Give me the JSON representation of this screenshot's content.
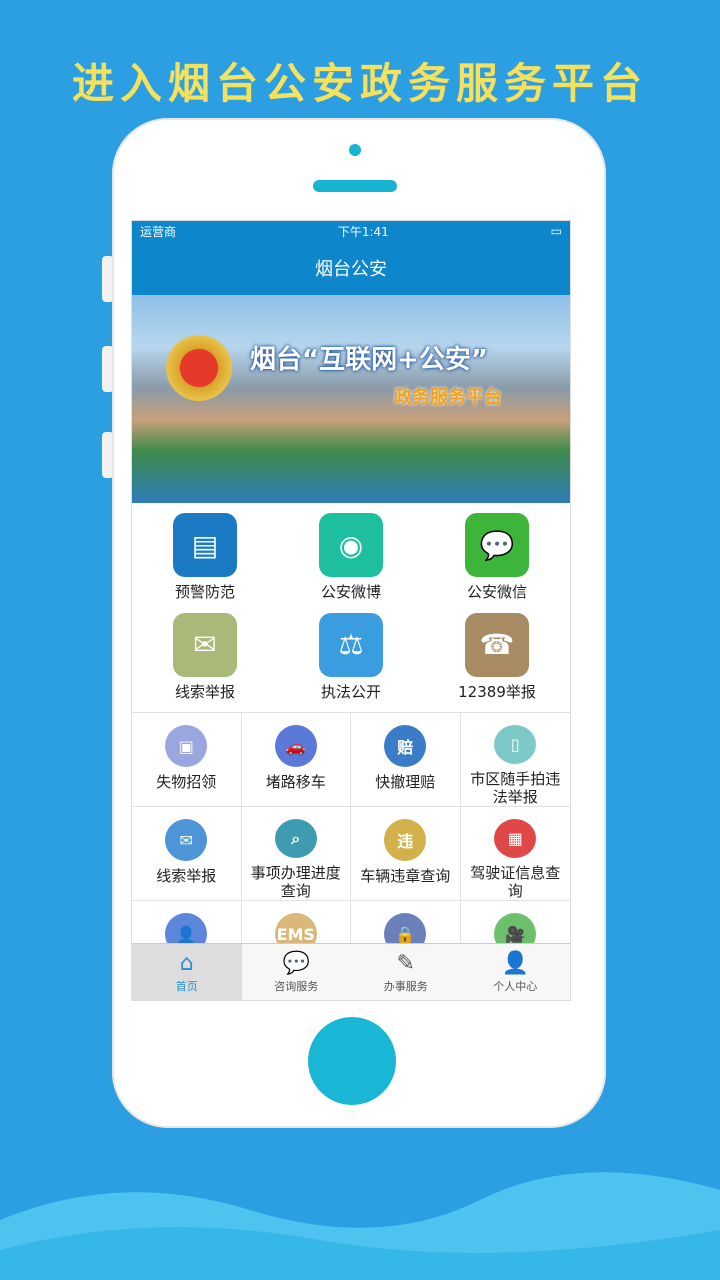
{
  "promo_title": "进入烟台公安政务服务平台",
  "status": {
    "carrier": "运营商",
    "time": "下午1:41"
  },
  "nav_title": "烟台公安",
  "banner": {
    "title": "烟台“互联网+公安”",
    "subtitle": "政务服务平台"
  },
  "main_services": [
    {
      "label": "预警防范",
      "icon": "newspaper-icon",
      "color": "#1a7bc4",
      "glyph": "▤"
    },
    {
      "label": "公安微博",
      "icon": "weibo-icon",
      "color": "#1dbf9e",
      "glyph": "◉"
    },
    {
      "label": "公安微信",
      "icon": "wechat-icon",
      "color": "#3db53a",
      "glyph": "💬"
    },
    {
      "label": "线索举报",
      "icon": "envelope-icon",
      "color": "#a9b97a",
      "glyph": "✉"
    },
    {
      "label": "执法公开",
      "icon": "scales-icon",
      "color": "#3a9de0",
      "glyph": "⚖"
    },
    {
      "label": "12389举报",
      "icon": "phone-24-icon",
      "color": "#a88b62",
      "glyph": "☎"
    }
  ],
  "sub_services": [
    {
      "label": "失物招领",
      "icon": "box-icon",
      "color": "#9aa6e0",
      "glyph": "▣"
    },
    {
      "label": "堵路移车",
      "icon": "car-icon",
      "color": "#5b79d8",
      "glyph": "🚗"
    },
    {
      "label": "快撤理赔",
      "icon": "shield-icon",
      "color": "#3b7cc8",
      "glyph": "赔"
    },
    {
      "label": "市区随手拍违法举报",
      "icon": "camera-phone-icon",
      "color": "#7dc9c8",
      "glyph": "▯"
    },
    {
      "label": "线索举报",
      "icon": "mail-icon",
      "color": "#4d95d6",
      "glyph": "✉"
    },
    {
      "label": "事项办理进度查询",
      "icon": "search-doc-icon",
      "color": "#3e9bb0",
      "glyph": "⌕"
    },
    {
      "label": "车辆违章查询",
      "icon": "violation-icon",
      "color": "#d2b04a",
      "glyph": "违"
    },
    {
      "label": "驾驶证信息查询",
      "icon": "license-icon",
      "color": "#e04848",
      "glyph": "▦"
    },
    {
      "label": "",
      "icon": "person-icon",
      "color": "#5b86dc",
      "glyph": "👤"
    },
    {
      "label": "",
      "icon": "ems-icon",
      "color": "#d9b77a",
      "glyph": "EMS"
    },
    {
      "label": "",
      "icon": "lock-icon",
      "color": "#6b7fbb",
      "glyph": "🔒"
    },
    {
      "label": "",
      "icon": "video-icon",
      "color": "#6cc06c",
      "glyph": "🎥"
    }
  ],
  "tabs": [
    {
      "label": "首页",
      "icon": "home-icon",
      "glyph": "⌂"
    },
    {
      "label": "咨询服务",
      "icon": "chat-icon",
      "glyph": "💬"
    },
    {
      "label": "办事服务",
      "icon": "edit-icon",
      "glyph": "✎"
    },
    {
      "label": "个人中心",
      "icon": "user-icon",
      "glyph": "👤"
    }
  ]
}
